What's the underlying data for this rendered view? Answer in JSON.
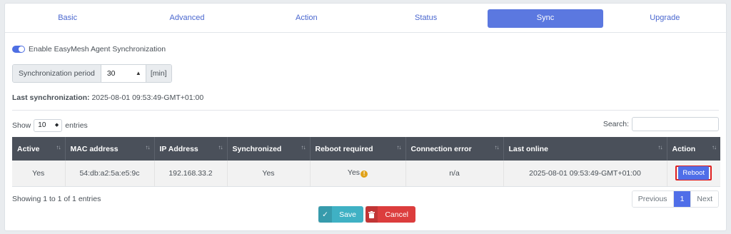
{
  "tabs": [
    {
      "label": "Basic"
    },
    {
      "label": "Advanced"
    },
    {
      "label": "Action"
    },
    {
      "label": "Status"
    },
    {
      "label": "Sync",
      "active": true
    },
    {
      "label": "Upgrade"
    }
  ],
  "sync": {
    "enable_label": "Enable EasyMesh Agent Synchronization",
    "enabled": true,
    "period_label": "Synchronization period",
    "period_value": "30",
    "period_unit": "[min]",
    "last_sync_label": "Last synchronization:",
    "last_sync_value": "2025-08-01 09:53:49-GMT+01:00"
  },
  "table_controls": {
    "show_label": "Show",
    "entries_value": "10",
    "entries_label": "entries",
    "search_label": "Search:"
  },
  "table": {
    "columns": [
      "Active",
      "MAC address",
      "IP Address",
      "Synchronized",
      "Reboot required",
      "Connection error",
      "Last online",
      "Action"
    ],
    "rows": [
      {
        "active": "Yes",
        "mac": "54:db:a2:5a:e5:9c",
        "ip": "192.168.33.2",
        "synchronized": "Yes",
        "reboot_required": "Yes",
        "connection_error": "n/a",
        "last_online": "2025-08-01 09:53:49-GMT+01:00",
        "action_label": "Reboot"
      }
    ]
  },
  "footer": {
    "showing": "Showing 1 to 1 of 1 entries",
    "pagination": {
      "previous": "Previous",
      "current": "1",
      "next": "Next"
    },
    "save_label": "Save",
    "cancel_label": "Cancel"
  },
  "colors": {
    "accent": "#5b78e0",
    "table_header": "#4a505a",
    "save": "#3fb1c4",
    "cancel": "#dc3d3d",
    "highlight": "#e02020",
    "warning": "#e0a21a"
  },
  "icons": {
    "sort": "sort-arrows-icon",
    "warning": "warning-icon",
    "save": "check-icon",
    "cancel": "trash-icon",
    "select": "chevron-up-down-icon"
  }
}
